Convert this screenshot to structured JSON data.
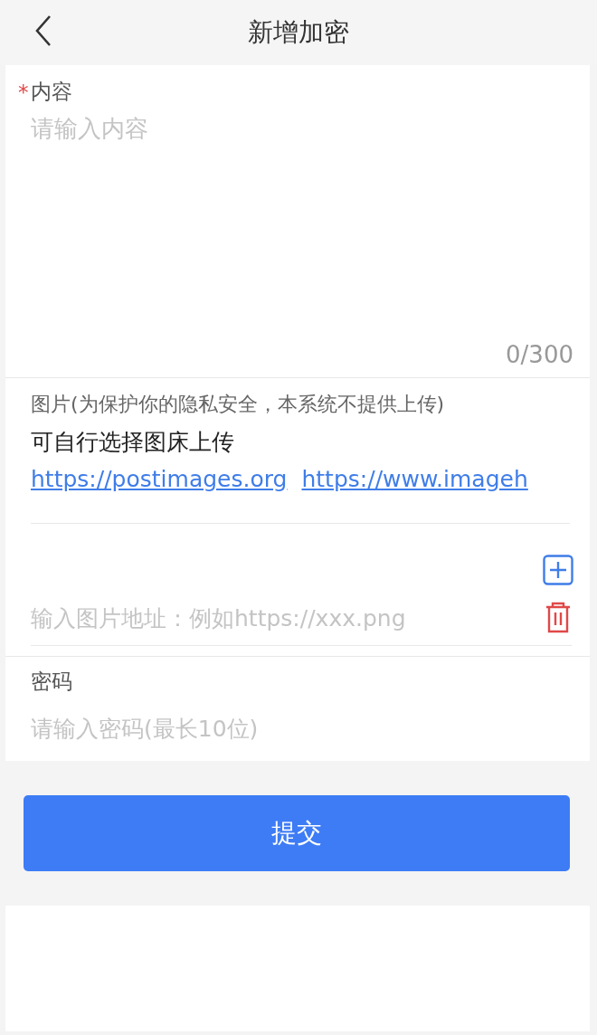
{
  "header": {
    "title": "新增加密"
  },
  "content_field": {
    "required_mark": "*",
    "label": "内容",
    "placeholder": "请输入内容",
    "counter": "0/300"
  },
  "images": {
    "label": "图片(为保护你的隐私安全，本系统不提供上传)",
    "hint": "可自行选择图床上传",
    "links": [
      "https://postimages.org",
      "https://www.imageh"
    ],
    "urls": [
      {
        "placeholder": "输入图片地址：例如https://xxx.png"
      }
    ]
  },
  "password_field": {
    "label": "密码",
    "placeholder": "请输入密码(最长10位)"
  },
  "submit": {
    "label": "提交"
  }
}
